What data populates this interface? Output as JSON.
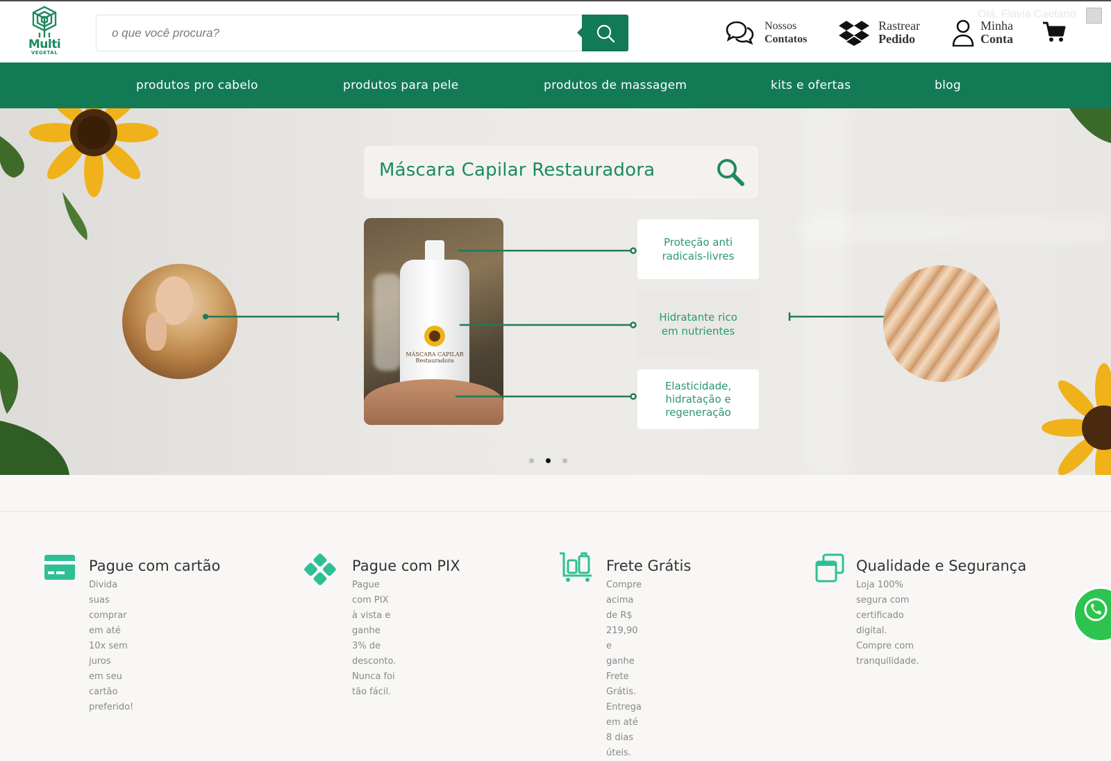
{
  "header": {
    "logo": {
      "line1": "Multi",
      "line2": "VEGETAL"
    },
    "search": {
      "placeholder": "o que você procura?"
    },
    "contacts": {
      "line1": "Nossos",
      "line2": "Contatos"
    },
    "track": {
      "line1": "Rastrear",
      "line2": "Pedido"
    },
    "account": {
      "line1": "Minha",
      "line2": "Conta"
    },
    "greeting": "Olá, Flávia Caetano",
    "cart_icon": "cart-icon"
  },
  "nav": {
    "items": [
      {
        "label": "produtos pro cabelo"
      },
      {
        "label": "produtos para pele"
      },
      {
        "label": "produtos de massagem"
      },
      {
        "label": "kits e ofertas"
      },
      {
        "label": "blog"
      }
    ]
  },
  "hero": {
    "title": "Máscara Capilar Restauradora",
    "bottle_label": "MÁSCARA CAPILAR Restauradora",
    "features": [
      {
        "text": "Proteção anti radicais-livres"
      },
      {
        "text": "Hidratante rico em nutrientes"
      },
      {
        "text": "Elasticidade, hidratação e regeneração"
      }
    ],
    "slides": {
      "count": 3,
      "active": 2
    },
    "accent_color": "#1d8a63"
  },
  "benefits": [
    {
      "title": "Pague com cartão",
      "desc1": "Divida suas comprar em até 10x sem juros",
      "desc2": "em seu cartão preferido!",
      "icon": "credit-card-icon"
    },
    {
      "title": "Pague com PIX",
      "desc1": "Pague com PIX à vista e ganhe 3% de",
      "desc2": "desconto. Nunca foi tão fácil.",
      "icon": "pix-icon"
    },
    {
      "title": "Frete Grátis",
      "desc1": "Compre acima de R$ 219,90 e ganhe",
      "desc2": "Frete Grátis. Entrega em até 8 dias úteis.",
      "icon": "luggage-cart-icon"
    },
    {
      "title": "Qualidade e Segurança",
      "desc1": "Loja 100% segura com certificado digital.",
      "desc2": "Compre com tranquilidade.",
      "icon": "windows-icon"
    }
  ],
  "colors": {
    "brand": "#137a56",
    "text": "#333333",
    "muted": "#888888",
    "whatsapp": "#2cc44f"
  }
}
